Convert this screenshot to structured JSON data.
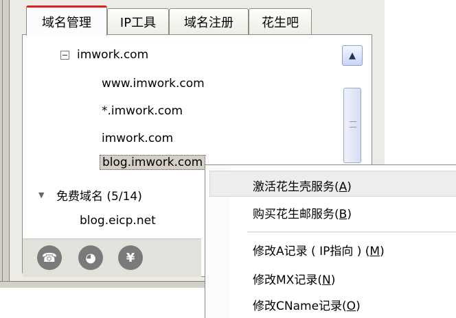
{
  "tabs": [
    {
      "label": "域名管理",
      "active": true
    },
    {
      "label": "IP工具",
      "active": false
    },
    {
      "label": "域名注册",
      "active": false
    },
    {
      "label": "花生吧",
      "active": false
    }
  ],
  "tree": {
    "root": "imwork.com",
    "children": [
      "www.imwork.com",
      "*.imwork.com",
      "imwork.com",
      "blog.imwork.com"
    ],
    "group_label": "免费域名 (5/14)",
    "group_items": [
      "blog.eicp.net"
    ]
  },
  "context_menu": {
    "items": [
      {
        "label": "激活花生壳服务",
        "key": "A"
      },
      {
        "label": "购买花生邮服务",
        "key": "B"
      },
      {
        "label": "修改A记录 ( IP指向 )",
        "key": "M"
      },
      {
        "label": "修改MX记录",
        "key": "N"
      },
      {
        "label": "修改CName记录",
        "key": "O"
      }
    ]
  },
  "icons": [
    "phone-icon",
    "chat-icon",
    "money-icon"
  ]
}
